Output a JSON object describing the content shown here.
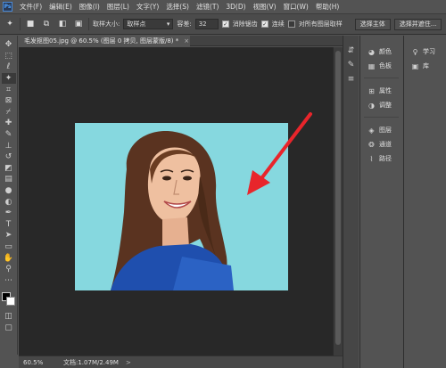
{
  "app": {
    "logo": "Ps"
  },
  "menu": [
    "文件(F)",
    "编辑(E)",
    "图像(I)",
    "图层(L)",
    "文字(Y)",
    "选择(S)",
    "滤镜(T)",
    "3D(D)",
    "视图(V)",
    "窗口(W)",
    "帮助(H)"
  ],
  "options": {
    "sample_size_label": "取样大小:",
    "sample_size_value": "取样点",
    "tolerance_label": "容差:",
    "tolerance_value": "32",
    "antialias_label": "消除锯齿",
    "contiguous_label": "连续",
    "sample_all_layers_label": "对所有图层取样",
    "select_subject_label": "选择主体",
    "select_and_mask_label": "选择并遮住..."
  },
  "document": {
    "tab_title": "毛发抠图05.jpg @ 60.5% (图层 0 拷贝, 图层蒙版/8) *",
    "close_glyph": "×"
  },
  "status": {
    "zoom": "60.5%",
    "doc_info": "文档:1.07M/2.49M",
    "arrow": ">"
  },
  "panels": {
    "col1": {
      "group1": [
        {
          "icon": "color-palette-icon",
          "label": "颜色"
        },
        {
          "icon": "swatches-icon",
          "label": "色板"
        }
      ],
      "group2": [
        {
          "icon": "properties-icon",
          "label": "属性"
        },
        {
          "icon": "adjustments-icon",
          "label": "调整"
        }
      ],
      "group3": [
        {
          "icon": "layers-icon",
          "label": "图层"
        },
        {
          "icon": "channels-icon",
          "label": "通道"
        },
        {
          "icon": "paths-icon",
          "label": "路径"
        }
      ]
    },
    "col2": [
      {
        "icon": "learn-icon",
        "label": "学习"
      },
      {
        "icon": "libraries-icon",
        "label": "库"
      }
    ]
  },
  "colors": {
    "foreground": "#000000",
    "background": "#ffffff",
    "photo_backdrop": "#86d8df",
    "arrow": "#e8252b",
    "shirt": "#1f4fae"
  }
}
